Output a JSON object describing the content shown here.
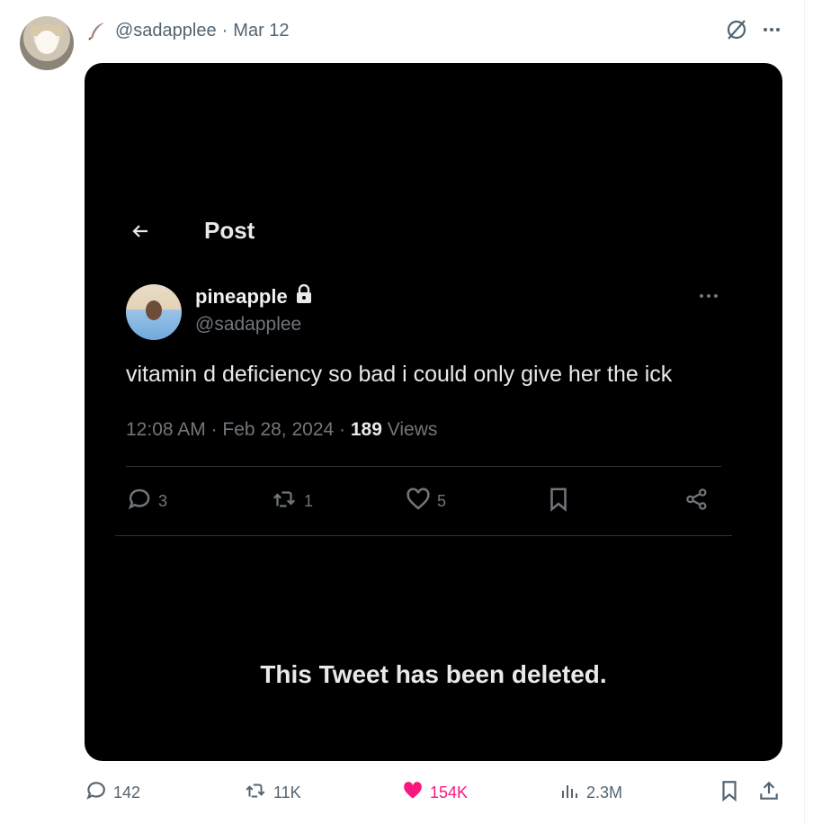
{
  "header": {
    "handle": "@sadapplee",
    "separator": "·",
    "date": "Mar 12",
    "emoji_icon": "feather-emoji-icon"
  },
  "media": {
    "nav_title": "Post",
    "author_name": "pineapple",
    "author_handle": "@sadapplee",
    "post_text": "vitamin d deficiency so bad i could only give her the ick",
    "time": "12:08 AM",
    "date": "Feb 28, 2024",
    "meta_sep": "·",
    "views_count": "189",
    "views_label": "Views",
    "replies": "3",
    "reposts": "1",
    "likes": "5",
    "deleted_notice": "This Tweet has been deleted."
  },
  "actions": {
    "replies": "142",
    "reposts": "11K",
    "likes": "154K",
    "views": "2.3M"
  },
  "colors": {
    "text_secondary": "#536471",
    "like_active": "#f91880",
    "media_bg": "#000000",
    "media_text": "#e7e9ea",
    "media_muted": "#71767b"
  }
}
